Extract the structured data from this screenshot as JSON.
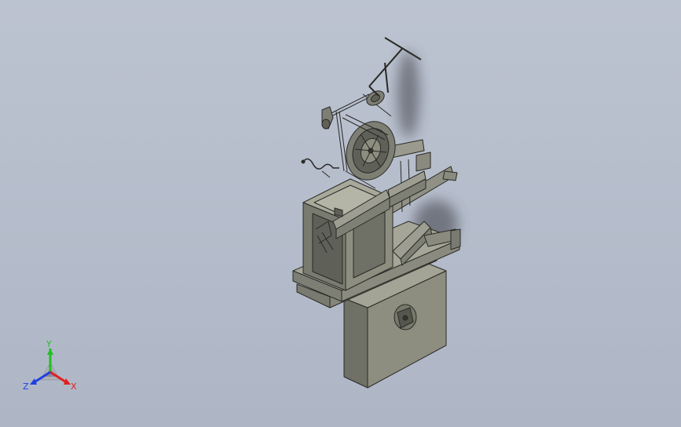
{
  "viewport": {
    "background_top": "#bcc3d0",
    "background_bottom": "#aeb6c6"
  },
  "model": {
    "body_color": "#8d8e80",
    "body_dark": "#5f6058",
    "edge_color": "#2a2a26",
    "shadow_color": "#3b3d44"
  },
  "triad": {
    "x_label": "X",
    "y_label": "Y",
    "z_label": "Z",
    "x_color": "#e02020",
    "y_color": "#20c020",
    "z_color": "#2040e0"
  }
}
